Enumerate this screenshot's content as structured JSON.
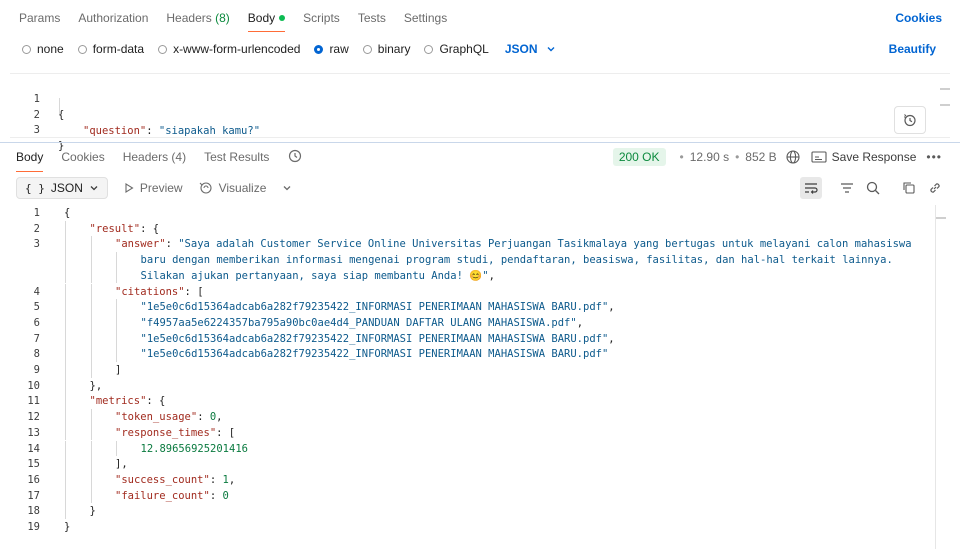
{
  "request_tabs": [
    {
      "label": "Params"
    },
    {
      "label": "Authorization"
    },
    {
      "label": "Headers",
      "count": "(8)"
    },
    {
      "label": "Body",
      "active": true
    },
    {
      "label": "Scripts"
    },
    {
      "label": "Tests"
    },
    {
      "label": "Settings"
    }
  ],
  "cookies_label": "Cookies",
  "body_types": [
    "none",
    "form-data",
    "x-www-form-urlencoded",
    "raw",
    "binary",
    "GraphQL"
  ],
  "body_type_selected": "raw",
  "body_language": "JSON",
  "beautify_label": "Beautify",
  "request_body": {
    "line_numbers": [
      "1",
      "2",
      "3"
    ],
    "open_brace": "{",
    "key": "\"question\"",
    "colon": ": ",
    "value": "\"siapakah kamu?\"",
    "close_brace": "}"
  },
  "response_tabs": [
    {
      "label": "Body",
      "active": true
    },
    {
      "label": "Cookies"
    },
    {
      "label": "Headers (4)"
    },
    {
      "label": "Test Results"
    }
  ],
  "response_status": {
    "status": "200 OK",
    "time": "12.90 s",
    "size": "852 B",
    "save_label": "Save Response"
  },
  "response_toolbar": {
    "format": "JSON",
    "preview": "Preview",
    "visualize": "Visualize"
  },
  "response_lines": [
    {
      "n": "1",
      "indent": 0,
      "parts": [
        [
          "pun",
          "{"
        ]
      ]
    },
    {
      "n": "2",
      "indent": 1,
      "parts": [
        [
          "key",
          "\"result\""
        ],
        [
          "pun",
          ": {"
        ]
      ]
    },
    {
      "n": "3",
      "indent": 2,
      "parts": [
        [
          "key",
          "\"answer\""
        ],
        [
          "pun",
          ": "
        ],
        [
          "str",
          "\"Saya adalah Customer Service Online Universitas Perjuangan Tasikmalaya yang bertugas untuk melayani calon mahasiswa"
        ]
      ]
    },
    {
      "n": "",
      "indent": 3,
      "parts": [
        [
          "str",
          "baru dengan memberikan informasi mengenai program studi, pendaftaran, beasiswa, fasilitas, dan hal-hal terkait lainnya."
        ]
      ]
    },
    {
      "n": "",
      "indent": 3,
      "parts": [
        [
          "str",
          "Silakan ajukan pertanyaan, saya siap membantu Anda! 😊\""
        ],
        [
          "pun",
          ","
        ]
      ]
    },
    {
      "n": "4",
      "indent": 2,
      "parts": [
        [
          "key",
          "\"citations\""
        ],
        [
          "pun",
          ": ["
        ]
      ]
    },
    {
      "n": "5",
      "indent": 3,
      "parts": [
        [
          "str",
          "\"1e5e0c6d15364adcab6a282f79235422_INFORMASI PENERIMAAN MAHASISWA BARU.pdf\""
        ],
        [
          "pun",
          ","
        ]
      ]
    },
    {
      "n": "6",
      "indent": 3,
      "parts": [
        [
          "str",
          "\"f4957aa5e6224357ba795a90bc0ae4d4_PANDUAN DAFTAR ULANG MAHASISWA.pdf\""
        ],
        [
          "pun",
          ","
        ]
      ]
    },
    {
      "n": "7",
      "indent": 3,
      "parts": [
        [
          "str",
          "\"1e5e0c6d15364adcab6a282f79235422_INFORMASI PENERIMAAN MAHASISWA BARU.pdf\""
        ],
        [
          "pun",
          ","
        ]
      ]
    },
    {
      "n": "8",
      "indent": 3,
      "parts": [
        [
          "str",
          "\"1e5e0c6d15364adcab6a282f79235422_INFORMASI PENERIMAAN MAHASISWA BARU.pdf\""
        ]
      ]
    },
    {
      "n": "9",
      "indent": 2,
      "parts": [
        [
          "pun",
          "]"
        ]
      ]
    },
    {
      "n": "10",
      "indent": 1,
      "parts": [
        [
          "pun",
          "},"
        ]
      ]
    },
    {
      "n": "11",
      "indent": 1,
      "parts": [
        [
          "key",
          "\"metrics\""
        ],
        [
          "pun",
          ": {"
        ]
      ]
    },
    {
      "n": "12",
      "indent": 2,
      "parts": [
        [
          "key",
          "\"token_usage\""
        ],
        [
          "pun",
          ": "
        ],
        [
          "num",
          "0"
        ],
        [
          "pun",
          ","
        ]
      ]
    },
    {
      "n": "13",
      "indent": 2,
      "parts": [
        [
          "key",
          "\"response_times\""
        ],
        [
          "pun",
          ": ["
        ]
      ]
    },
    {
      "n": "14",
      "indent": 3,
      "parts": [
        [
          "num",
          "12.89656925201416"
        ]
      ]
    },
    {
      "n": "15",
      "indent": 2,
      "parts": [
        [
          "pun",
          "],"
        ]
      ]
    },
    {
      "n": "16",
      "indent": 2,
      "parts": [
        [
          "key",
          "\"success_count\""
        ],
        [
          "pun",
          ": "
        ],
        [
          "num",
          "1"
        ],
        [
          "pun",
          ","
        ]
      ]
    },
    {
      "n": "17",
      "indent": 2,
      "parts": [
        [
          "key",
          "\"failure_count\""
        ],
        [
          "pun",
          ": "
        ],
        [
          "num",
          "0"
        ]
      ]
    },
    {
      "n": "18",
      "indent": 1,
      "parts": [
        [
          "pun",
          "}"
        ]
      ]
    },
    {
      "n": "19",
      "indent": 0,
      "parts": [
        [
          "pun",
          "}"
        ]
      ]
    }
  ]
}
